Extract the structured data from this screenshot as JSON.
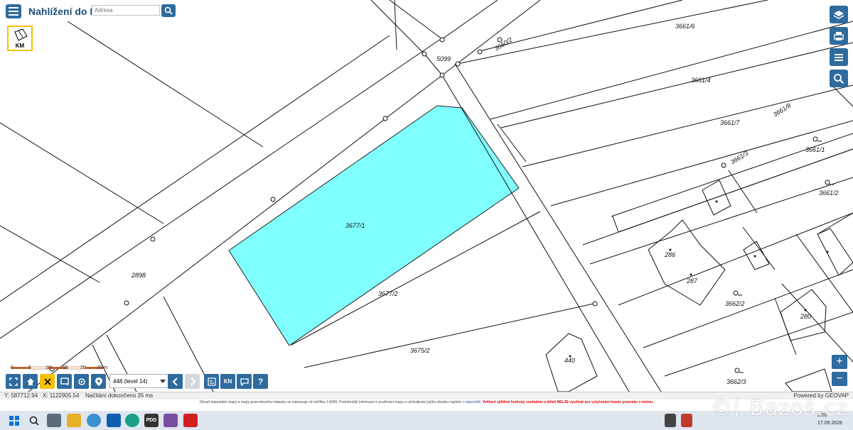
{
  "app": {
    "title": "Nahlížení do KN",
    "address_placeholder": "Adresa"
  },
  "km_button": {
    "label": "KM"
  },
  "parcels": {
    "p1": "3661/6",
    "p2": "5099",
    "p3": "3660/2",
    "p4": "3661/4",
    "p5": "3661/7",
    "p6": "3661/8",
    "p7": "3661/1",
    "p8": "3661/3",
    "p9": "3661/2",
    "p10": "3677/1",
    "p11": "2898",
    "p12": "286",
    "p13": "287",
    "p14": "3662/2",
    "p15": "280",
    "p16": "3677/2",
    "p17": "3675/2",
    "p18": "440",
    "p19": "3662/3"
  },
  "scale": {
    "labels": [
      "0",
      "5",
      "10",
      "15",
      "20",
      "25 m"
    ]
  },
  "toolbar": {
    "level": "448 (level 14)",
    "kn_label": "KN",
    "help_label": "?"
  },
  "status": {
    "y": "Y: 587712.94",
    "x": "X: 1122905.54",
    "load": "Načítání dokončeno 35 ms",
    "powered": "Powered by GEOVAP"
  },
  "disclaimer": {
    "text": "Obsah katastrální mapy a mapy pozemkového katastru se zobrazuje od měřítka 1:5000. Podrobnější informace k používání mapy a vyhledávání jejího obsahu najdete",
    "link": "v nápovědě.",
    "warning": "Veškeré zjištěné hodnoty souřadnic a délek NELZE využívat pro vytyčování hranic pozemku v terénu."
  },
  "taskbar": {
    "pdd": "PDD",
    "time": "2:02",
    "date": "17.09.2026"
  },
  "watermark": "©( Bazoš.cz",
  "colors": {
    "accent": "#2e6b9e",
    "parcel_highlight": "#80ffff",
    "km_border": "#f2c200"
  }
}
